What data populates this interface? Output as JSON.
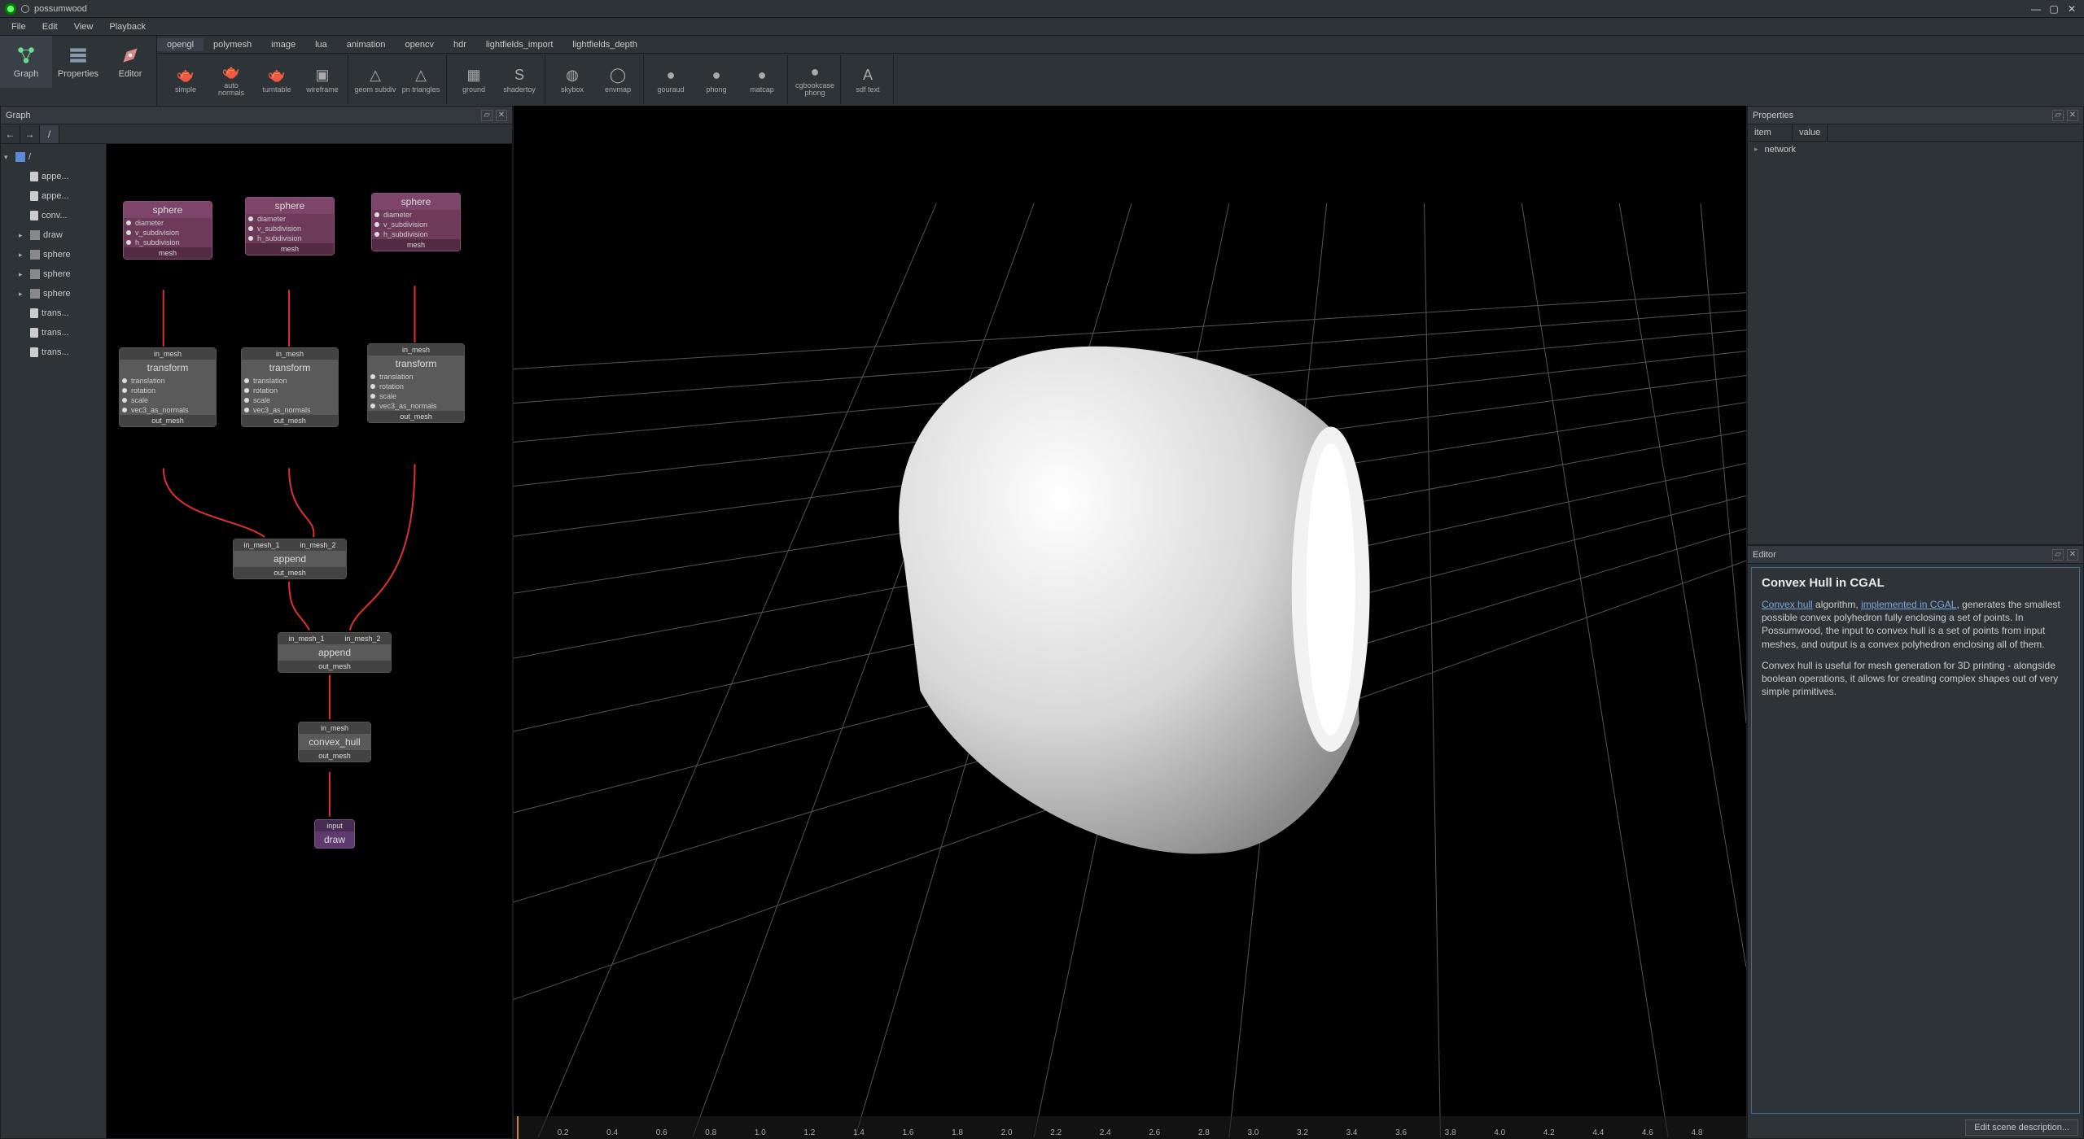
{
  "window": {
    "title": "possumwood"
  },
  "menu": [
    "File",
    "Edit",
    "View",
    "Playback"
  ],
  "modes": [
    {
      "label": "Graph",
      "active": true
    },
    {
      "label": "Properties",
      "active": false
    },
    {
      "label": "Editor",
      "active": false
    }
  ],
  "tool_tabs": [
    "opengl",
    "polymesh",
    "image",
    "lua",
    "animation",
    "opencv",
    "hdr",
    "lightfields_import",
    "lightfields_depth"
  ],
  "active_tool_tab": "opengl",
  "tool_groups": [
    [
      {
        "label": "simple",
        "icon": "teapot-icon"
      },
      {
        "label": "auto normals",
        "icon": "teapot-icon"
      },
      {
        "label": "turntable",
        "icon": "teapot-icon"
      },
      {
        "label": "wireframe",
        "icon": "cube-icon"
      }
    ],
    [
      {
        "label": "geom subdiv",
        "icon": "cone-icon"
      },
      {
        "label": "pn triangles",
        "icon": "cone-icon"
      }
    ],
    [
      {
        "label": "ground",
        "icon": "grid-icon"
      },
      {
        "label": "shadertoy",
        "icon": "s-icon"
      }
    ],
    [
      {
        "label": "skybox",
        "icon": "globe-icon"
      },
      {
        "label": "envmap",
        "icon": "ring-icon"
      }
    ],
    [
      {
        "label": "gouraud",
        "icon": "sphere-icon"
      },
      {
        "label": "phong",
        "icon": "sphere-icon"
      },
      {
        "label": "matcap",
        "icon": "sphere-icon"
      }
    ],
    [
      {
        "label": "cgbookcase phong",
        "icon": "sphere-icon"
      }
    ],
    [
      {
        "label": "sdf text",
        "icon": "a-icon"
      }
    ]
  ],
  "graph": {
    "panel_title": "Graph",
    "path": "/",
    "tree": [
      {
        "label": "/",
        "kind": "root",
        "expandable": true
      },
      {
        "label": "appe...",
        "kind": "leaf"
      },
      {
        "label": "appe...",
        "kind": "leaf"
      },
      {
        "label": "conv...",
        "kind": "leaf"
      },
      {
        "label": "draw",
        "kind": "folder",
        "expandable": true
      },
      {
        "label": "sphere",
        "kind": "folder",
        "expandable": true
      },
      {
        "label": "sphere",
        "kind": "folder",
        "expandable": true
      },
      {
        "label": "sphere",
        "kind": "folder",
        "expandable": true
      },
      {
        "label": "trans...",
        "kind": "leaf"
      },
      {
        "label": "trans...",
        "kind": "leaf"
      },
      {
        "label": "trans...",
        "kind": "leaf"
      }
    ],
    "nodes": {
      "sphere_ports": [
        "diameter",
        "v_subdivision",
        "h_subdivision"
      ],
      "sphere_out": "mesh",
      "transform_in": "in_mesh",
      "transform_title": "transform",
      "transform_ports": [
        "translation",
        "rotation",
        "scale",
        "vec3_as_normals"
      ],
      "transform_out": "out_mesh",
      "append_title": "append",
      "append_in1": "in_mesh_1",
      "append_in2": "in_mesh_2",
      "append_out": "out_mesh",
      "convex_title": "convex_hull",
      "convex_in": "in_mesh",
      "convex_out": "out_mesh",
      "draw_title": "draw",
      "draw_in": "input",
      "sphere_title": "sphere"
    }
  },
  "timeline_ticks": [
    "0.2",
    "0.4",
    "0.6",
    "0.8",
    "1.0",
    "1.2",
    "1.4",
    "1.6",
    "1.8",
    "2.0",
    "2.2",
    "2.4",
    "2.6",
    "2.8",
    "3.0",
    "3.2",
    "3.4",
    "3.6",
    "3.8",
    "4.0",
    "4.2",
    "4.4",
    "4.6",
    "4.8"
  ],
  "properties": {
    "panel_title": "Properties",
    "col_item": "item",
    "col_value": "value",
    "row0": "network"
  },
  "editor": {
    "panel_title": "Editor",
    "heading": "Convex Hull in CGAL",
    "link1": "Convex hull",
    "frag1": " algorithm, ",
    "link2": "implemented in CGAL",
    "frag2": ", generates the smallest possible convex polyhedron fully enclosing a set of points. In Possumwood, the input to convex hull is a set of points from input meshes, and output is a convex polyhedron enclosing all of them.",
    "para2": "Convex hull is useful for mesh generation for 3D printing - alongside boolean operations, it allows for creating complex shapes out of very simple primitives.",
    "button": "Edit scene description..."
  }
}
